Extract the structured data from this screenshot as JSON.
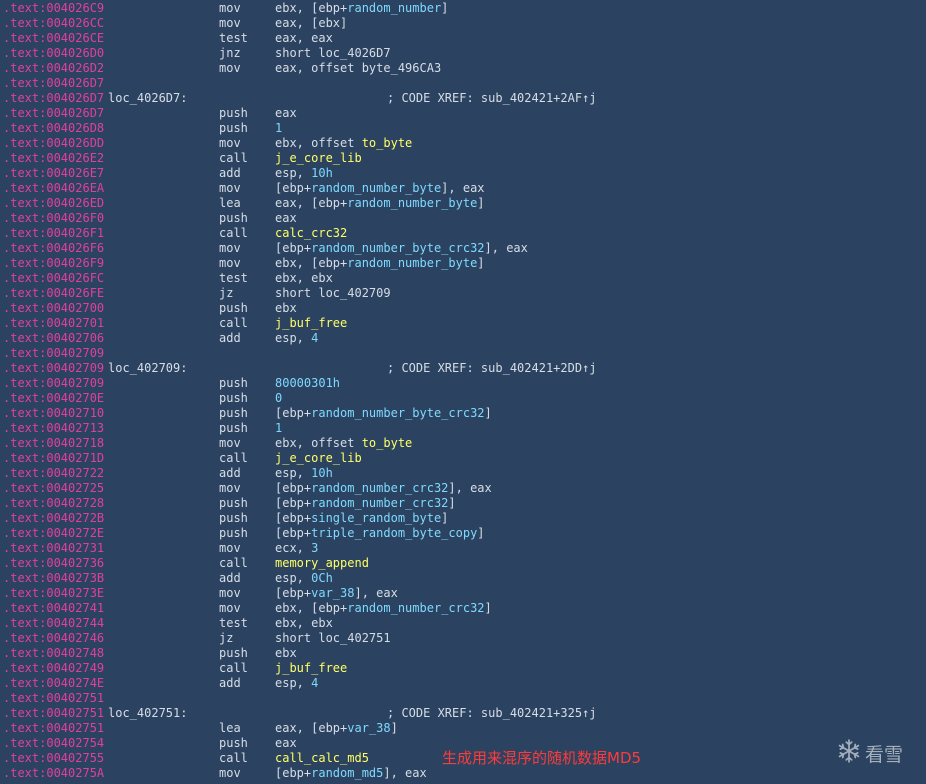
{
  "lines": [
    {
      "addr": ".text:004026C9",
      "mn": "mov",
      "ops": [
        [
          "ebx, [ebp+",
          "plain"
        ],
        [
          "random_number",
          "var"
        ],
        [
          "]",
          "plain"
        ]
      ]
    },
    {
      "addr": ".text:004026CC",
      "mn": "mov",
      "ops": [
        [
          "eax, [ebx]",
          "plain"
        ]
      ]
    },
    {
      "addr": ".text:004026CE",
      "mn": "test",
      "ops": [
        [
          "eax, eax",
          "plain"
        ]
      ]
    },
    {
      "addr": ".text:004026D0",
      "mn": "jnz",
      "ops": [
        [
          "short loc_4026D7",
          "plain"
        ]
      ]
    },
    {
      "addr": ".text:004026D2",
      "mn": "mov",
      "ops": [
        [
          "eax, offset byte_496CA3",
          "plain"
        ]
      ]
    },
    {
      "addr": ".text:004026D7"
    },
    {
      "addr": ".text:004026D7",
      "label": "loc_4026D7:",
      "comment": "; CODE XREF: sub_402421+2AF↑j"
    },
    {
      "addr": ".text:004026D7",
      "mn": "push",
      "ops": [
        [
          "eax",
          "plain"
        ]
      ]
    },
    {
      "addr": ".text:004026D8",
      "mn": "push",
      "ops": [
        [
          "1",
          "num"
        ]
      ]
    },
    {
      "addr": ".text:004026DD",
      "mn": "mov",
      "ops": [
        [
          "ebx, offset ",
          "plain"
        ],
        [
          "to_byte",
          "func"
        ]
      ]
    },
    {
      "addr": ".text:004026E2",
      "mn": "call",
      "ops": [
        [
          "j_e_core_lib",
          "func"
        ]
      ]
    },
    {
      "addr": ".text:004026E7",
      "mn": "add",
      "ops": [
        [
          "esp, ",
          "plain"
        ],
        [
          "10h",
          "num"
        ]
      ]
    },
    {
      "addr": ".text:004026EA",
      "mn": "mov",
      "ops": [
        [
          "[ebp+",
          "plain"
        ],
        [
          "random_number_byte",
          "var"
        ],
        [
          "], eax",
          "plain"
        ]
      ]
    },
    {
      "addr": ".text:004026ED",
      "mn": "lea",
      "ops": [
        [
          "eax, [ebp+",
          "plain"
        ],
        [
          "random_number_byte",
          "var"
        ],
        [
          "]",
          "plain"
        ]
      ]
    },
    {
      "addr": ".text:004026F0",
      "mn": "push",
      "ops": [
        [
          "eax",
          "plain"
        ]
      ]
    },
    {
      "addr": ".text:004026F1",
      "mn": "call",
      "ops": [
        [
          "calc_crc32",
          "func"
        ]
      ]
    },
    {
      "addr": ".text:004026F6",
      "mn": "mov",
      "ops": [
        [
          "[ebp+",
          "plain"
        ],
        [
          "random_number_byte_crc32",
          "var"
        ],
        [
          "], eax",
          "plain"
        ]
      ]
    },
    {
      "addr": ".text:004026F9",
      "mn": "mov",
      "ops": [
        [
          "ebx, [ebp+",
          "plain"
        ],
        [
          "random_number_byte",
          "var"
        ],
        [
          "]",
          "plain"
        ]
      ]
    },
    {
      "addr": ".text:004026FC",
      "mn": "test",
      "ops": [
        [
          "ebx, ebx",
          "plain"
        ]
      ]
    },
    {
      "addr": ".text:004026FE",
      "mn": "jz",
      "ops": [
        [
          "short loc_402709",
          "plain"
        ]
      ]
    },
    {
      "addr": ".text:00402700",
      "mn": "push",
      "ops": [
        [
          "ebx",
          "plain"
        ]
      ]
    },
    {
      "addr": ".text:00402701",
      "mn": "call",
      "ops": [
        [
          "j_buf_free",
          "func"
        ]
      ]
    },
    {
      "addr": ".text:00402706",
      "mn": "add",
      "ops": [
        [
          "esp, ",
          "plain"
        ],
        [
          "4",
          "num"
        ]
      ]
    },
    {
      "addr": ".text:00402709"
    },
    {
      "addr": ".text:00402709",
      "label": "loc_402709:",
      "comment": "; CODE XREF: sub_402421+2DD↑j"
    },
    {
      "addr": ".text:00402709",
      "mn": "push",
      "ops": [
        [
          "80000301h",
          "num"
        ]
      ]
    },
    {
      "addr": ".text:0040270E",
      "mn": "push",
      "ops": [
        [
          "0",
          "num"
        ]
      ]
    },
    {
      "addr": ".text:00402710",
      "mn": "push",
      "ops": [
        [
          "[ebp+",
          "plain"
        ],
        [
          "random_number_byte_crc32",
          "var"
        ],
        [
          "]",
          "plain"
        ]
      ]
    },
    {
      "addr": ".text:00402713",
      "mn": "push",
      "ops": [
        [
          "1",
          "num"
        ]
      ]
    },
    {
      "addr": ".text:00402718",
      "mn": "mov",
      "ops": [
        [
          "ebx, offset ",
          "plain"
        ],
        [
          "to_byte",
          "func"
        ]
      ]
    },
    {
      "addr": ".text:0040271D",
      "mn": "call",
      "ops": [
        [
          "j_e_core_lib",
          "func"
        ]
      ]
    },
    {
      "addr": ".text:00402722",
      "mn": "add",
      "ops": [
        [
          "esp, ",
          "plain"
        ],
        [
          "10h",
          "num"
        ]
      ]
    },
    {
      "addr": ".text:00402725",
      "mn": "mov",
      "ops": [
        [
          "[ebp+",
          "plain"
        ],
        [
          "random_number_crc32",
          "var"
        ],
        [
          "], eax",
          "plain"
        ]
      ]
    },
    {
      "addr": ".text:00402728",
      "mn": "push",
      "ops": [
        [
          "[ebp+",
          "plain"
        ],
        [
          "random_number_crc32",
          "var"
        ],
        [
          "]",
          "plain"
        ]
      ]
    },
    {
      "addr": ".text:0040272B",
      "mn": "push",
      "ops": [
        [
          "[ebp+",
          "plain"
        ],
        [
          "single_random_byte",
          "var"
        ],
        [
          "]",
          "plain"
        ]
      ]
    },
    {
      "addr": ".text:0040272E",
      "mn": "push",
      "ops": [
        [
          "[ebp+",
          "plain"
        ],
        [
          "triple_random_byte_copy",
          "var"
        ],
        [
          "]",
          "plain"
        ]
      ]
    },
    {
      "addr": ".text:00402731",
      "mn": "mov",
      "ops": [
        [
          "ecx, ",
          "plain"
        ],
        [
          "3",
          "num"
        ]
      ]
    },
    {
      "addr": ".text:00402736",
      "mn": "call",
      "ops": [
        [
          "memory_append",
          "func"
        ]
      ]
    },
    {
      "addr": ".text:0040273B",
      "mn": "add",
      "ops": [
        [
          "esp, ",
          "plain"
        ],
        [
          "0Ch",
          "num"
        ]
      ]
    },
    {
      "addr": ".text:0040273E",
      "mn": "mov",
      "ops": [
        [
          "[ebp+",
          "plain"
        ],
        [
          "var_38",
          "var"
        ],
        [
          "], eax",
          "plain"
        ]
      ]
    },
    {
      "addr": ".text:00402741",
      "mn": "mov",
      "ops": [
        [
          "ebx, [ebp+",
          "plain"
        ],
        [
          "random_number_crc32",
          "var"
        ],
        [
          "]",
          "plain"
        ]
      ]
    },
    {
      "addr": ".text:00402744",
      "mn": "test",
      "ops": [
        [
          "ebx, ebx",
          "plain"
        ]
      ]
    },
    {
      "addr": ".text:00402746",
      "mn": "jz",
      "ops": [
        [
          "short loc_402751",
          "plain"
        ]
      ]
    },
    {
      "addr": ".text:00402748",
      "mn": "push",
      "ops": [
        [
          "ebx",
          "plain"
        ]
      ]
    },
    {
      "addr": ".text:00402749",
      "mn": "call",
      "ops": [
        [
          "j_buf_free",
          "func"
        ]
      ]
    },
    {
      "addr": ".text:0040274E",
      "mn": "add",
      "ops": [
        [
          "esp, ",
          "plain"
        ],
        [
          "4",
          "num"
        ]
      ]
    },
    {
      "addr": ".text:00402751"
    },
    {
      "addr": ".text:00402751",
      "label": "loc_402751:",
      "comment": "; CODE XREF: sub_402421+325↑j"
    },
    {
      "addr": ".text:00402751",
      "mn": "lea",
      "ops": [
        [
          "eax, [ebp+",
          "plain"
        ],
        [
          "var_38",
          "var"
        ],
        [
          "]",
          "plain"
        ]
      ]
    },
    {
      "addr": ".text:00402754",
      "mn": "push",
      "ops": [
        [
          "eax",
          "plain"
        ]
      ]
    },
    {
      "addr": ".text:00402755",
      "mn": "call",
      "ops": [
        [
          "call_calc_md5",
          "func"
        ]
      ]
    },
    {
      "addr": ".text:0040275A",
      "mn": "mov",
      "ops": [
        [
          "[ebp+",
          "plain"
        ],
        [
          "random_md5",
          "var"
        ],
        [
          "], eax",
          "plain"
        ]
      ]
    }
  ],
  "annotation": "生成用来混序的随机数据MD5",
  "watermark": {
    "text": "看雪",
    "icon": "snowflake-icon"
  },
  "colors": {
    "background": "#2b4360",
    "address": "#e0409a",
    "text": "#d6dde6",
    "variable": "#7fd9ff",
    "function": "#ffff66",
    "annotation": "#ff3a3a"
  }
}
